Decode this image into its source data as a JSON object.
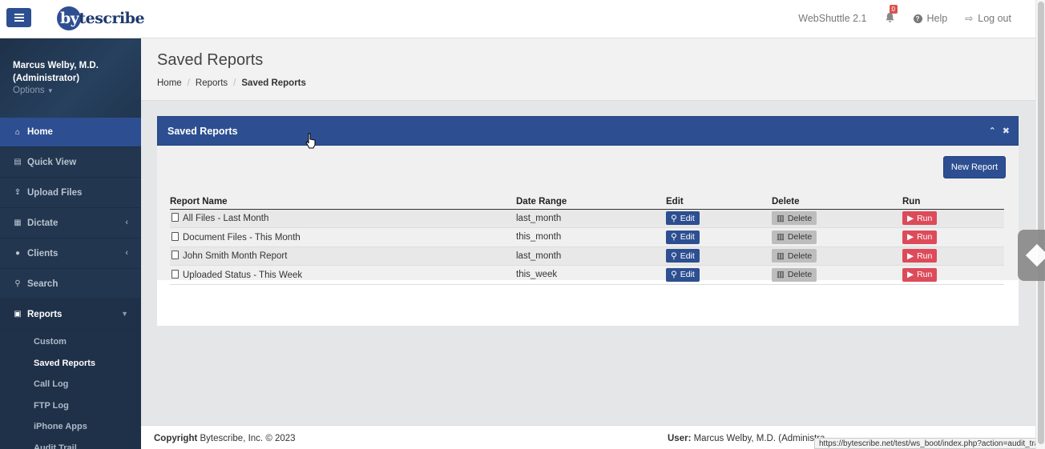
{
  "topbar": {
    "menu_icon": "hamburger-icon",
    "logo_text_1": "by",
    "logo_text_2": "tescribe",
    "app_version": "WebShuttle 2.1",
    "notification_count": "0",
    "help_label": "Help",
    "logout_label": "Log out"
  },
  "sidebar": {
    "user_name": "Marcus Welby, M.D.",
    "user_role": "(Administrator)",
    "options_label": "Options",
    "items": [
      {
        "label": "Home",
        "icon": "home-icon"
      },
      {
        "label": "Quick View",
        "icon": "document-icon"
      },
      {
        "label": "Upload Files",
        "icon": "upload-icon"
      },
      {
        "label": "Dictate",
        "icon": "dictate-icon"
      },
      {
        "label": "Clients",
        "icon": "users-icon"
      },
      {
        "label": "Search",
        "icon": "search-icon"
      },
      {
        "label": "Reports",
        "icon": "reports-icon"
      }
    ],
    "report_subitems": [
      "Custom",
      "Saved Reports",
      "Call Log",
      "FTP Log",
      "iPhone Apps",
      "Audit Trail"
    ]
  },
  "page": {
    "title": "Saved Reports",
    "breadcrumb": [
      "Home",
      "Reports",
      "Saved Reports"
    ]
  },
  "panel": {
    "title": "Saved Reports",
    "new_report_label": "New Report",
    "columns": [
      "Report Name",
      "Date Range",
      "Edit",
      "Delete",
      "Run"
    ],
    "edit_label": "Edit",
    "delete_label": "Delete",
    "run_label": "Run",
    "rows": [
      {
        "name": "All Files - Last Month",
        "range": "last_month"
      },
      {
        "name": "Document Files - This Month",
        "range": "this_month"
      },
      {
        "name": "John Smith Month Report",
        "range": "last_month"
      },
      {
        "name": "Uploaded Status - This Week",
        "range": "this_week"
      }
    ]
  },
  "footer": {
    "copyright_label": "Copyright",
    "copyright_text": " Bytescribe, Inc. © 2023",
    "user_label": "User:",
    "user_text": " Marcus Welby, M.D. (Administra",
    "status_url": "https://bytescribe.net/test/ws_boot/index.php?action=audit_trail"
  },
  "colors": {
    "accent": "#2d4f91",
    "sidebar": "#22364f",
    "run": "#dd4b5a"
  }
}
